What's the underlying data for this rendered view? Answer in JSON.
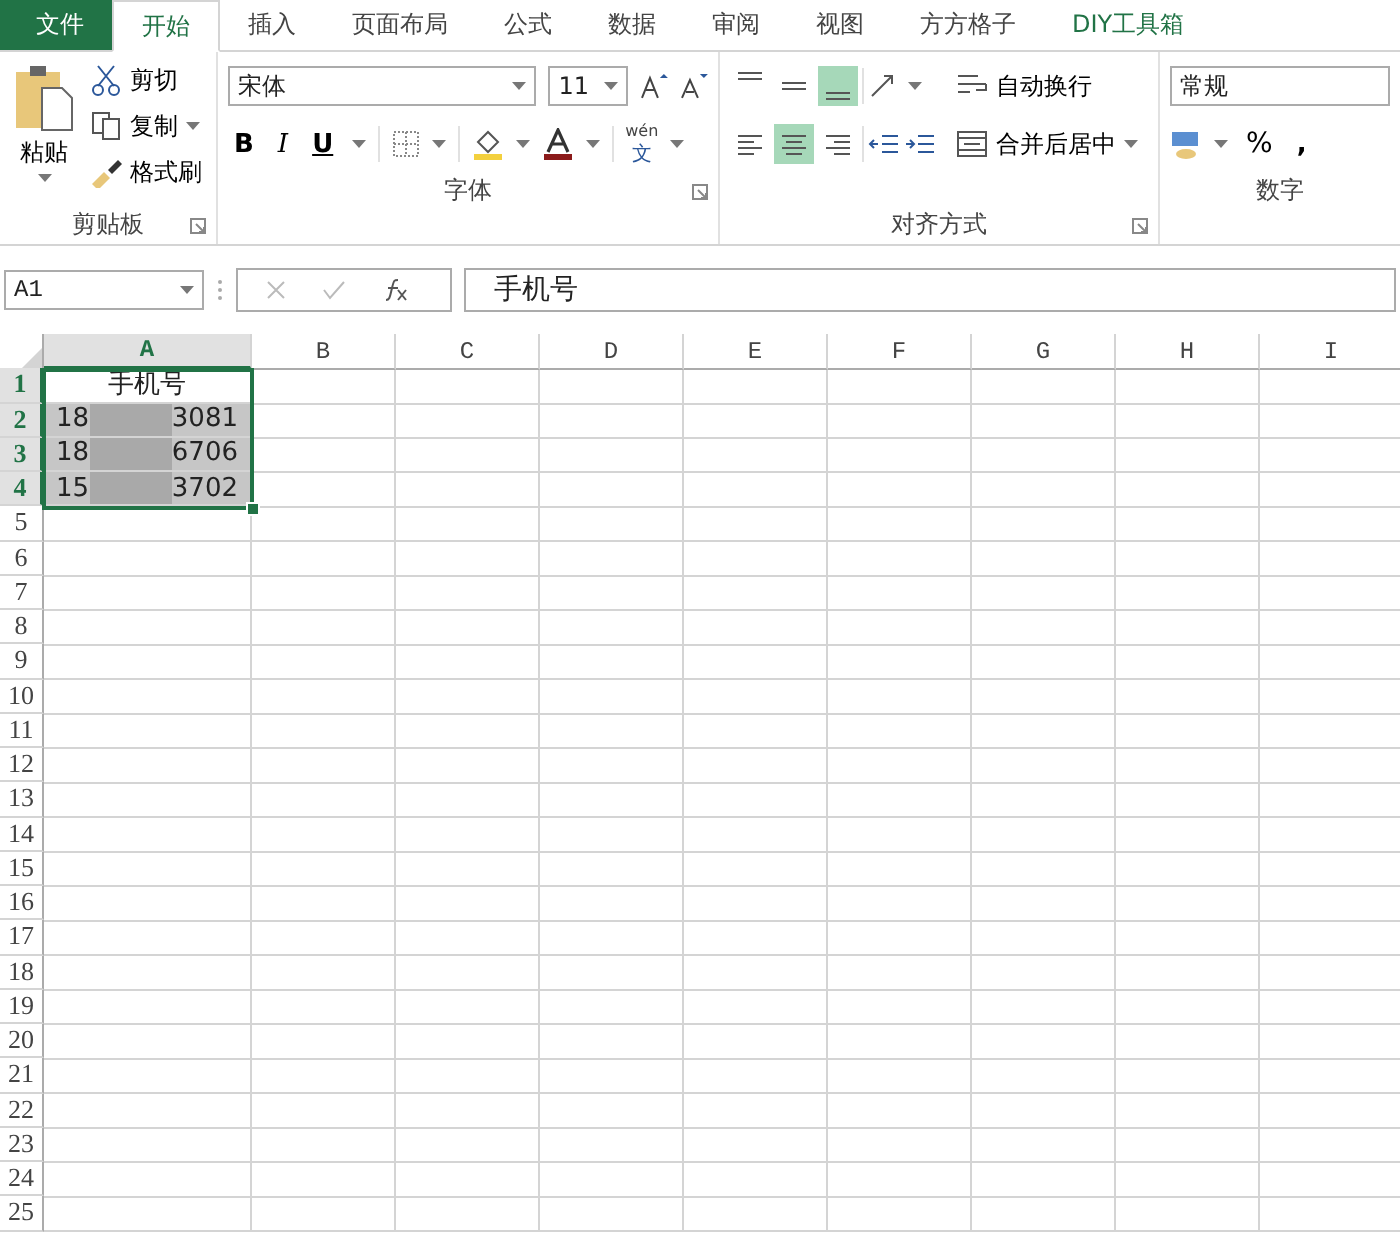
{
  "tabs": [
    {
      "label": "文件",
      "kind": "file",
      "selected": false
    },
    {
      "label": "开始",
      "kind": "tab",
      "selected": true
    },
    {
      "label": "插入",
      "kind": "tab",
      "selected": false
    },
    {
      "label": "页面布局",
      "kind": "tab",
      "selected": false
    },
    {
      "label": "公式",
      "kind": "tab",
      "selected": false
    },
    {
      "label": "数据",
      "kind": "tab",
      "selected": false
    },
    {
      "label": "审阅",
      "kind": "tab",
      "selected": false
    },
    {
      "label": "视图",
      "kind": "tab",
      "selected": false
    },
    {
      "label": "方方格子",
      "kind": "tab",
      "selected": false
    },
    {
      "label": "DIY工具箱",
      "kind": "addin",
      "selected": false
    }
  ],
  "clipboard": {
    "paste": "粘贴",
    "cut": "剪切",
    "copy": "复制",
    "format_painter": "格式刷",
    "label": "剪贴板"
  },
  "font": {
    "name": "宋体",
    "size": "11",
    "bold": "B",
    "italic": "I",
    "underline": "U",
    "phonetic_top": "wén",
    "phonetic_bottom": "文",
    "label": "字体"
  },
  "alignment": {
    "vertical": [
      {
        "selected": false
      },
      {
        "selected": false
      },
      {
        "selected": true
      }
    ],
    "horizontal": [
      {
        "selected": false
      },
      {
        "selected": true
      },
      {
        "selected": false
      }
    ],
    "wrap": "自动换行",
    "merge": "合并后居中",
    "label": "对齐方式"
  },
  "number": {
    "format": "常规",
    "percent": "%",
    "comma": ",",
    "label": "数字"
  },
  "name_box": "A1",
  "formula": "手机号",
  "columns": [
    {
      "label": "A",
      "selected": true
    },
    {
      "label": "B",
      "selected": false
    },
    {
      "label": "C",
      "selected": false
    },
    {
      "label": "D",
      "selected": false
    },
    {
      "label": "E",
      "selected": false
    },
    {
      "label": "F",
      "selected": false
    },
    {
      "label": "G",
      "selected": false
    },
    {
      "label": "H",
      "selected": false
    },
    {
      "label": "I",
      "selected": false
    }
  ],
  "rows": [
    {
      "label": "1",
      "selected": true,
      "cells": [
        {
          "kind": "text",
          "text": "手机号",
          "selected": false
        }
      ]
    },
    {
      "label": "2",
      "selected": true,
      "cells": [
        {
          "kind": "masked",
          "prefix": "18",
          "suffix": "3081",
          "selected": true
        }
      ]
    },
    {
      "label": "3",
      "selected": true,
      "cells": [
        {
          "kind": "masked",
          "prefix": "18",
          "suffix": "6706",
          "selected": true
        }
      ]
    },
    {
      "label": "4",
      "selected": true,
      "cells": [
        {
          "kind": "masked",
          "prefix": "15",
          "suffix": "3702",
          "selected": true
        }
      ]
    },
    {
      "label": "5",
      "selected": false
    },
    {
      "label": "6",
      "selected": false
    },
    {
      "label": "7",
      "selected": false
    },
    {
      "label": "8",
      "selected": false
    },
    {
      "label": "9",
      "selected": false
    },
    {
      "label": "10",
      "selected": false
    },
    {
      "label": "11",
      "selected": false
    },
    {
      "label": "12",
      "selected": false
    },
    {
      "label": "13",
      "selected": false
    },
    {
      "label": "14",
      "selected": false
    },
    {
      "label": "15",
      "selected": false
    },
    {
      "label": "16",
      "selected": false
    },
    {
      "label": "17",
      "selected": false
    },
    {
      "label": "18",
      "selected": false
    },
    {
      "label": "19",
      "selected": false
    },
    {
      "label": "20",
      "selected": false
    },
    {
      "label": "21",
      "selected": false
    },
    {
      "label": "22",
      "selected": false
    },
    {
      "label": "23",
      "selected": false
    },
    {
      "label": "24",
      "selected": false
    },
    {
      "label": "25",
      "selected": false
    }
  ]
}
